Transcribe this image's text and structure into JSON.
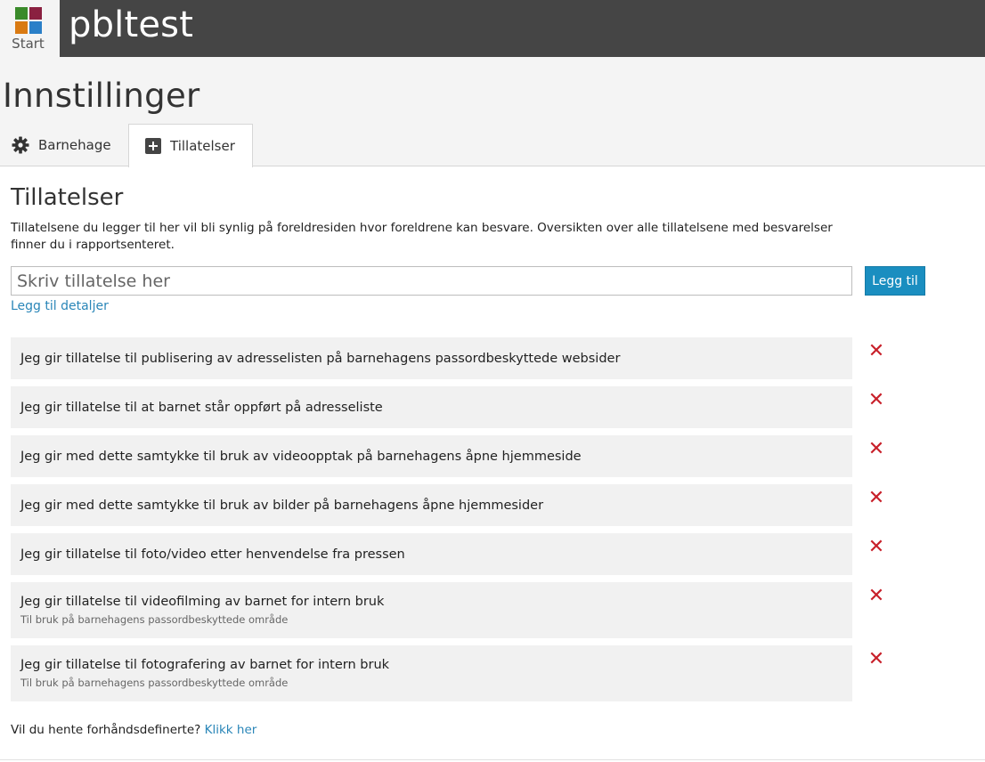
{
  "app": {
    "start_label": "Start",
    "title": "pbltest"
  },
  "page": {
    "title": "Innstillinger",
    "tabs": [
      {
        "label": "Barnehage",
        "icon": "gear-icon"
      },
      {
        "label": "Tillatelser",
        "icon": "plus-box-icon",
        "active": true
      }
    ]
  },
  "section": {
    "title": "Tillatelser",
    "description": "Tillatelsene du legger til her vil bli synlig på foreldresiden hvor foreldrene kan besvare. Oversikten over alle tillatelsene med besvarelser finner du i rapportsenteret.",
    "input_placeholder": "Skriv tillatelse her",
    "input_value": "",
    "add_button": "Legg til",
    "details_link": "Legg til detaljer"
  },
  "permissions": [
    {
      "text": "Jeg gir tillatelse til publisering av adresselisten på barnehagens passordbeskyttede websider",
      "sub": ""
    },
    {
      "text": "Jeg gir tillatelse til at barnet står oppført på adresseliste",
      "sub": ""
    },
    {
      "text": "Jeg gir med dette samtykke til bruk av videoopptak på barnehagens åpne hjemmeside",
      "sub": ""
    },
    {
      "text": "Jeg gir med dette samtykke til bruk av bilder på barnehagens åpne hjemmesider",
      "sub": ""
    },
    {
      "text": "Jeg gir tillatelse til foto/video etter henvendelse fra pressen",
      "sub": ""
    },
    {
      "text": "Jeg gir tillatelse til videofilming av barnet for intern bruk",
      "sub": "Til bruk på barnehagens passordbeskyttede område"
    },
    {
      "text": "Jeg gir tillatelse til fotografering av barnet for intern bruk",
      "sub": "Til bruk på barnehagens passordbeskyttede område"
    }
  ],
  "delete_icon": "close-x-icon",
  "footer": {
    "question": "Vil du hente forhåndsdefinerte?",
    "link": "Klikk her"
  },
  "colors": {
    "topbar": "#454545",
    "accent": "#1a8ec0",
    "link": "#2a86b8",
    "delete": "#c8202a"
  }
}
